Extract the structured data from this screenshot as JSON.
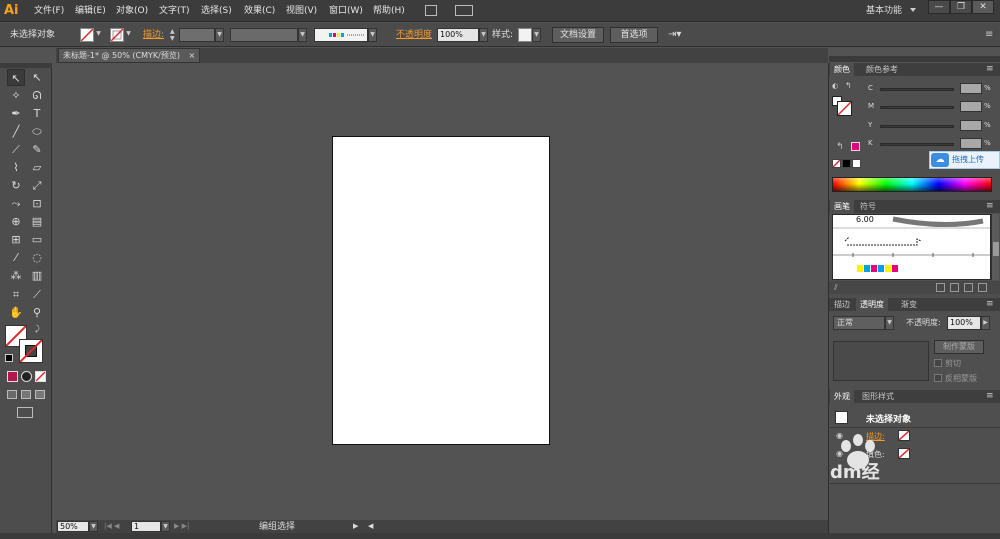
{
  "app": {
    "logo": "Ai"
  },
  "menu": {
    "items": [
      "文件(F)",
      "编辑(E)",
      "对象(O)",
      "文字(T)",
      "选择(S)",
      "效果(C)",
      "视图(V)",
      "窗口(W)",
      "帮助(H)"
    ],
    "workspace": "基本功能",
    "min": "—",
    "restore": "❐",
    "close": "✕"
  },
  "control": {
    "selection_status": "未选择对象",
    "stroke_label": "描边:",
    "opacity_label": "不透明度",
    "opacity_value": "100%",
    "style_label": "样式:",
    "doc_setup": "文档设置",
    "prefs": "首选项"
  },
  "document": {
    "tab_title": "未标题-1* @ 50% (CMYK/预览)",
    "tab_close": "×"
  },
  "color_panel": {
    "tab_color": "颜色",
    "tab_guide": "颜色参考",
    "channels": [
      "C",
      "M",
      "Y",
      "K"
    ],
    "pct": "%",
    "accent_magenta": "#e4007f",
    "upload_label": "拖拽上传"
  },
  "brushes_panel": {
    "tab_brushes": "画笔",
    "tab_symbols": "符号",
    "brush_size": "6.00"
  },
  "transparency_panel": {
    "tab_stroke": "描边",
    "tab_transparency": "透明度",
    "tab_gradient": "渐变",
    "mode": "正常",
    "opacity_label": "不透明度:",
    "opacity_value": "100%",
    "make_mask": "制作蒙版",
    "clip": "剪切",
    "invert": "反相蒙版"
  },
  "appearance_panel": {
    "tab_appearance": "外观",
    "tab_graphic_styles": "图形样式",
    "title": "未选择对象",
    "stroke_label": "描边:",
    "fill_label": "填色:"
  },
  "status": {
    "zoom": "50%",
    "artboard": "1",
    "tool_status": "编组选择"
  },
  "watermark": {
    "text": "dm经"
  }
}
